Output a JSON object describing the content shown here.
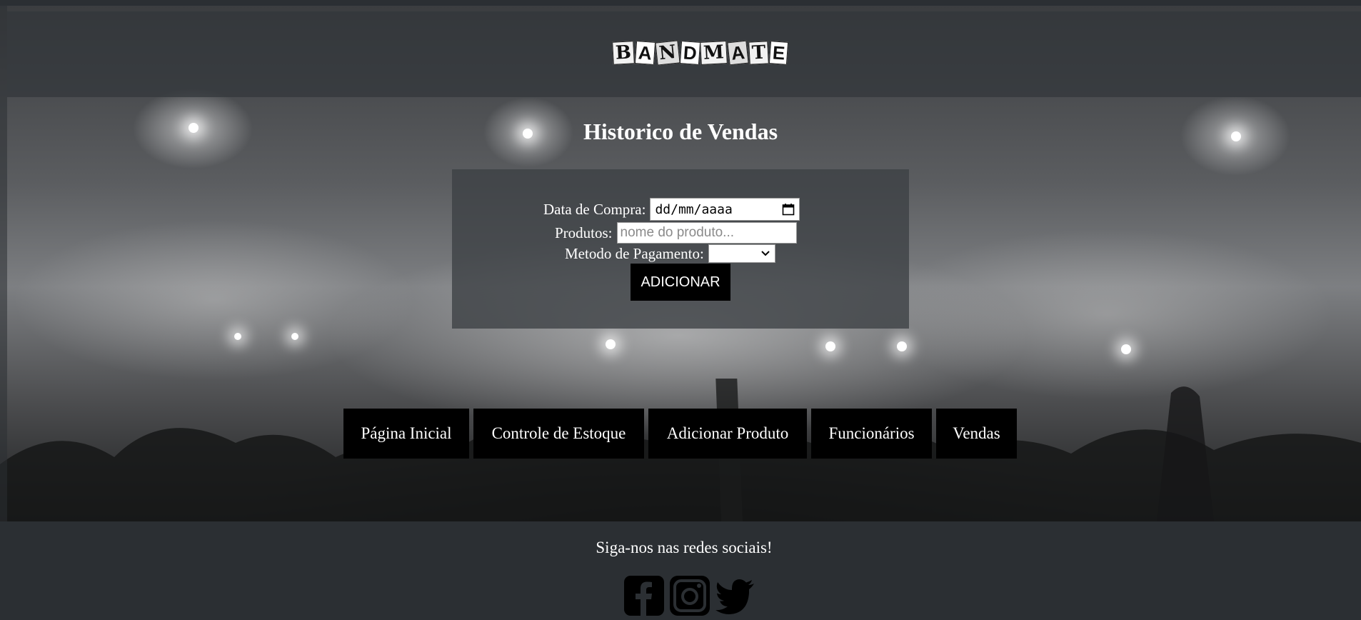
{
  "brand": {
    "logo_letters": [
      "B",
      "A",
      "N",
      "D",
      "M",
      "A",
      "T",
      "E"
    ]
  },
  "page": {
    "title": "Historico de Vendas"
  },
  "form": {
    "date_label": "Data de Compra:",
    "date_placeholder": "dd/mm/aaaa",
    "products_label": "Produtos:",
    "products_placeholder": "nome do produto...",
    "payment_label": "Metodo de Pagamento:",
    "payment_value": "",
    "submit_label": "ADICIONAR"
  },
  "nav": {
    "items": [
      {
        "label": "Página Inicial"
      },
      {
        "label": "Controle de Estoque"
      },
      {
        "label": "Adicionar Produto"
      },
      {
        "label": "Funcionários"
      },
      {
        "label": "Vendas"
      }
    ]
  },
  "footer": {
    "text": "Siga-nos nas redes sociais!",
    "icons": [
      "facebook-icon",
      "instagram-icon",
      "twitter-icon"
    ]
  },
  "colors": {
    "nav_bg": "#000000",
    "footer_bg": "#2b2f33",
    "text": "#ffffff"
  }
}
